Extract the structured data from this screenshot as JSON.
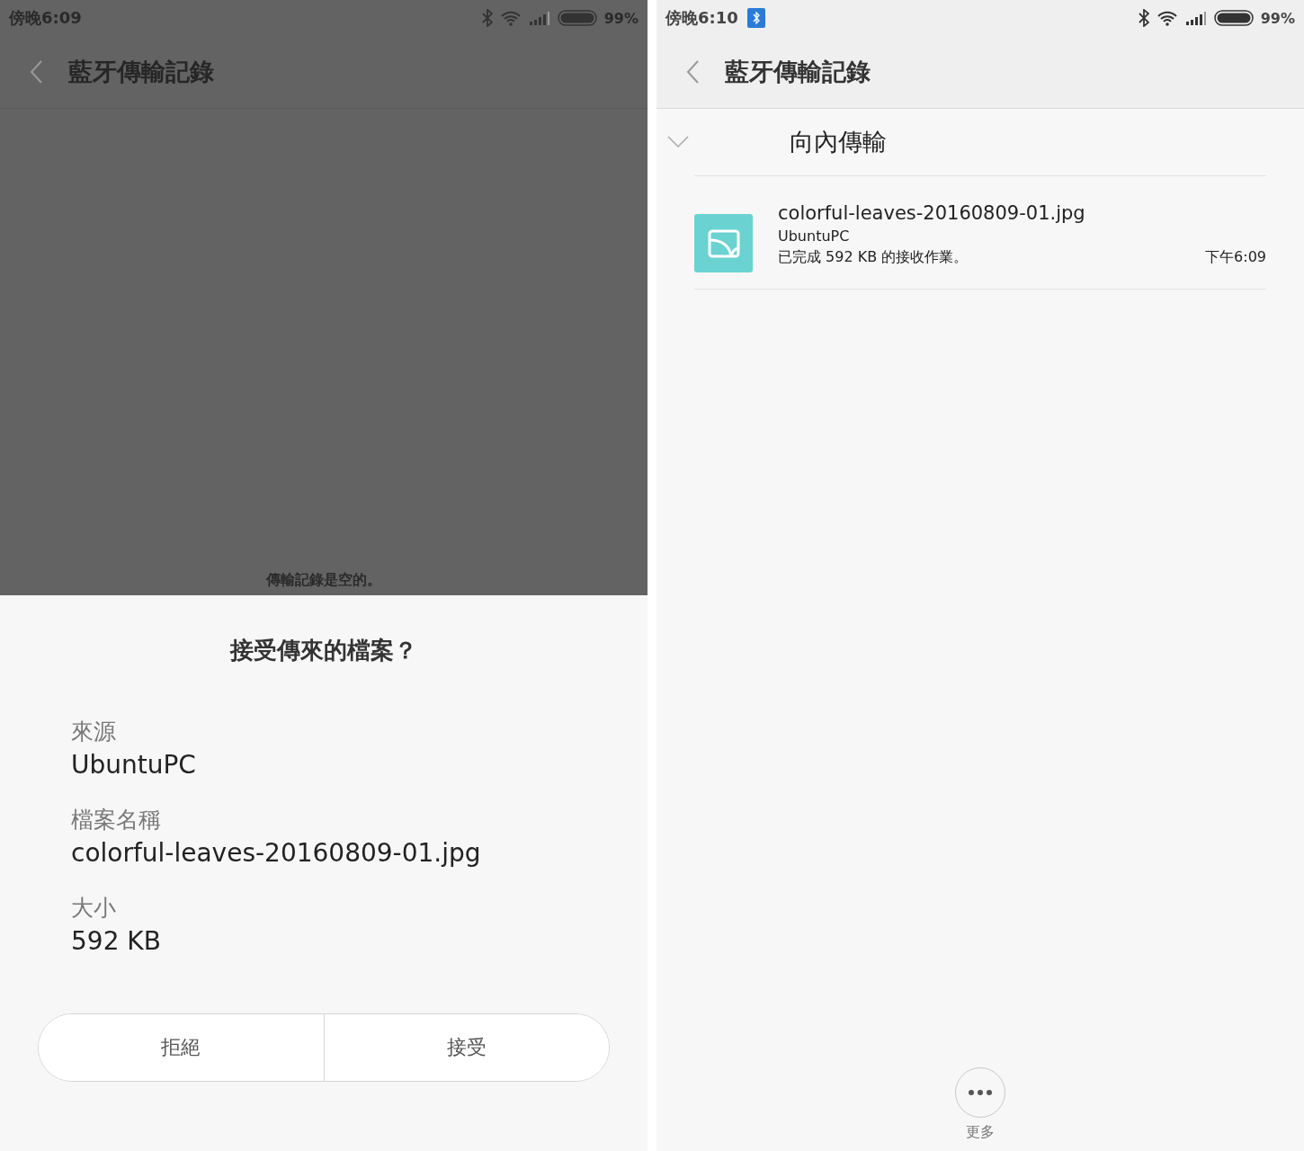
{
  "left_screen": {
    "dimmed": true,
    "status_bar": {
      "time": "傍晚6:09",
      "bluetooth_notification": false,
      "battery": "99%"
    },
    "header": {
      "title": "藍牙傳輸記錄"
    },
    "empty_message": "傳輸記錄是空的。",
    "dialog": {
      "title": "接受傳來的檔案？",
      "fields": [
        {
          "label": "來源",
          "value": "UbuntuPC"
        },
        {
          "label": "檔案名稱",
          "value": "colorful-leaves-20160809-01.jpg"
        },
        {
          "label": "大小",
          "value": "592 KB"
        }
      ],
      "buttons": [
        "拒絕",
        "接受"
      ]
    }
  },
  "right_screen": {
    "dimmed": false,
    "status_bar": {
      "time": "傍晚6:10",
      "bluetooth_notification": true,
      "battery": "99%"
    },
    "header": {
      "title": "藍牙傳輸記錄"
    },
    "section": {
      "title": "向內傳輸",
      "expanded": true,
      "items": [
        {
          "file_name": "colorful-leaves-20160809-01.jpg",
          "device": "UbuntuPC",
          "status": "已完成 592 KB 的接收作業。",
          "time": "下午6:09"
        }
      ]
    },
    "more_button": {
      "label": "更多"
    }
  }
}
